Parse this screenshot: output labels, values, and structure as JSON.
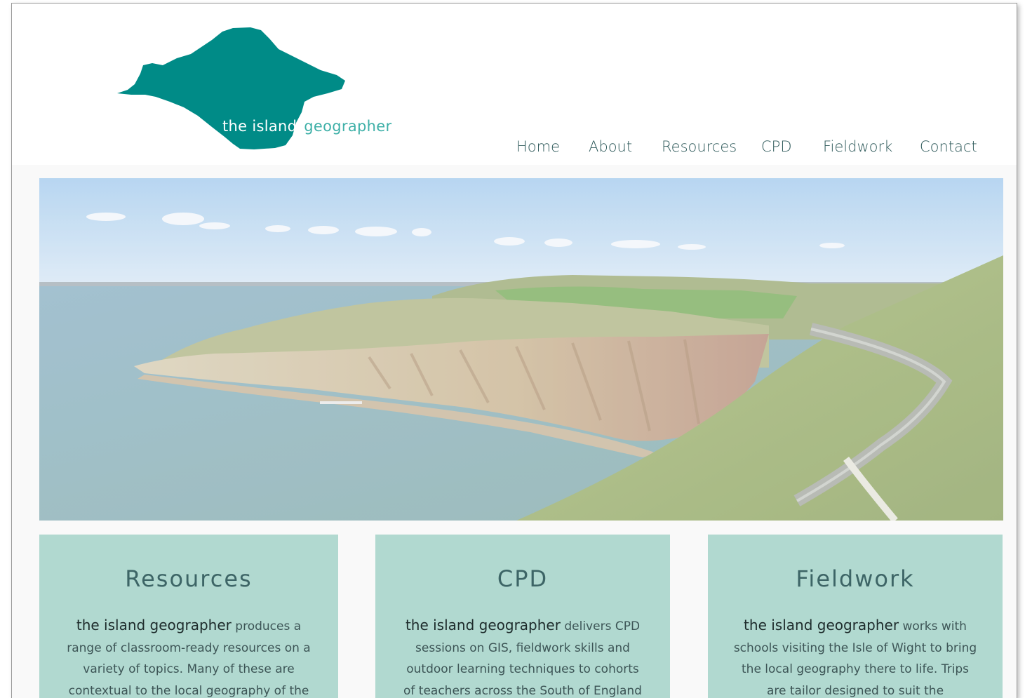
{
  "logo": {
    "word1": "the island",
    "word2": "geographer",
    "colors": {
      "island": "#008b87",
      "word1": "#ffffff",
      "word2": "#3fb0a8"
    }
  },
  "nav": {
    "items": [
      "Home",
      "About",
      "Resources",
      "CPD",
      "Fieldwork",
      "Contact"
    ]
  },
  "hero": {
    "icon": "coastal-cliffs-photo"
  },
  "cards": [
    {
      "title": "Resources",
      "brand": "the island geographer",
      "text": "produces a range of classroom-ready resources on a variety of topics. Many of these are contextual to the local geography of the"
    },
    {
      "title": "CPD",
      "brand": "the island geographer",
      "text": "delivers CPD sessions on GIS, fieldwork skills and outdoor learning techniques to cohorts of teachers across the South of England"
    },
    {
      "title": "Fieldwork",
      "brand": "the island geographer",
      "text": "works with schools visiting the Isle of Wight to bring the local geography there to life. Trips are tailor designed to suit the"
    }
  ],
  "colors": {
    "card_bg": "#b1d9d0",
    "nav_text": "#2f5a5b",
    "page_bg": "#f9f9f9"
  }
}
